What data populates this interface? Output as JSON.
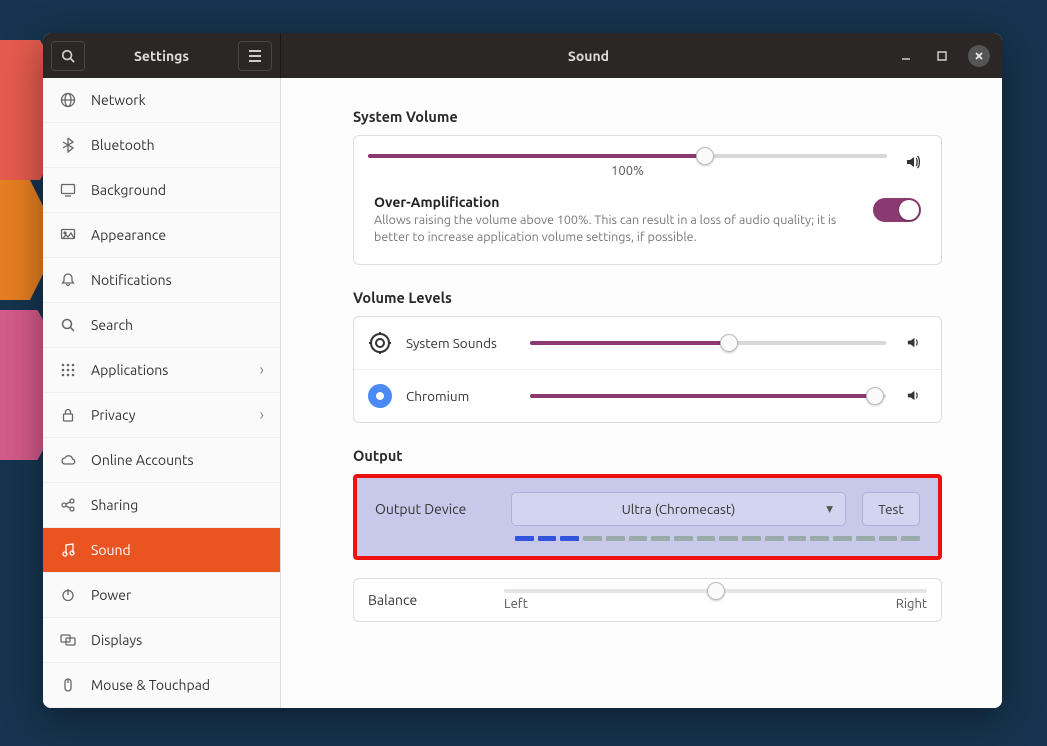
{
  "titlebar": {
    "left_title": "Settings",
    "right_title": "Sound"
  },
  "sidebar": {
    "items": [
      {
        "label": "Network",
        "icon": "globe-icon",
        "chevron": false
      },
      {
        "label": "Bluetooth",
        "icon": "bluetooth-icon",
        "chevron": false
      },
      {
        "label": "Background",
        "icon": "monitor-icon",
        "chevron": false
      },
      {
        "label": "Appearance",
        "icon": "appearance-icon",
        "chevron": false
      },
      {
        "label": "Notifications",
        "icon": "bell-icon",
        "chevron": false
      },
      {
        "label": "Search",
        "icon": "search-icon",
        "chevron": false
      },
      {
        "label": "Applications",
        "icon": "grid-icon",
        "chevron": true
      },
      {
        "label": "Privacy",
        "icon": "lock-icon",
        "chevron": true
      },
      {
        "label": "Online Accounts",
        "icon": "cloud-icon",
        "chevron": false
      },
      {
        "label": "Sharing",
        "icon": "share-icon",
        "chevron": false
      },
      {
        "label": "Sound",
        "icon": "music-icon",
        "chevron": false,
        "active": true
      },
      {
        "label": "Power",
        "icon": "power-icon",
        "chevron": false
      },
      {
        "label": "Displays",
        "icon": "displays-icon",
        "chevron": false
      },
      {
        "label": "Mouse & Touchpad",
        "icon": "mouse-icon",
        "chevron": false
      }
    ]
  },
  "sections": {
    "system_volume": {
      "title": "System Volume",
      "percent_label": "100%",
      "percent_value": 65,
      "overamp_title": "Over-Amplification",
      "overamp_desc": "Allows raising the volume above 100%. This can result in a loss of audio quality; it is better to increase application volume settings, if possible.",
      "overamp_enabled": true
    },
    "volume_levels": {
      "title": "Volume Levels",
      "apps": [
        {
          "name": "System Sounds",
          "icon": "system-sounds-icon",
          "value": 56
        },
        {
          "name": "Chromium",
          "icon": "chromium-icon",
          "value": 97
        }
      ]
    },
    "output": {
      "title": "Output",
      "device_label": "Output Device",
      "selected_device": "Ultra (Chromecast)",
      "test_label": "Test",
      "meter_active_segments": 3,
      "meter_total_segments": 18,
      "balance_label": "Balance",
      "balance_value": 50,
      "balance_left": "Left",
      "balance_right": "Right"
    }
  }
}
